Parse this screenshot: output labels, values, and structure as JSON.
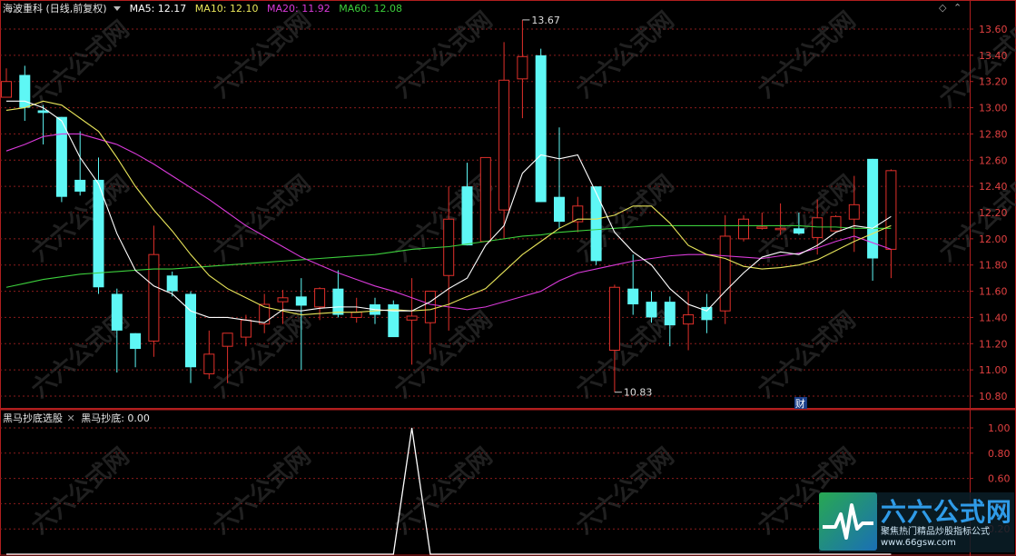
{
  "header": {
    "title": "海波重科 (日线,前复权)",
    "ma5": "MA5: 12.17",
    "ma10": "MA10: 12.10",
    "ma20": "MA20: 11.92",
    "ma60": "MA60: 12.08",
    "corner_icon": "diamond-icon",
    "menu_icon": "chevron-down-icon"
  },
  "indicator": {
    "name": "黑马抄底选股",
    "value_label": "黑马抄底: 0.00",
    "close_icon": "close-icon"
  },
  "price_axis": [
    "13.60",
    "13.40",
    "13.20",
    "13.00",
    "12.80",
    "12.60",
    "12.40",
    "12.20",
    "12.00",
    "11.80",
    "11.60",
    "11.40",
    "11.20",
    "11.00",
    "10.80"
  ],
  "indicator_axis": [
    "1.00",
    "0.80",
    "0.60",
    "0.40",
    "0.20"
  ],
  "annotations": {
    "high": "13.67",
    "low": "10.83",
    "fin_badge": "财"
  },
  "watermark": "六六公式网",
  "brand": {
    "name": "六六公式网",
    "slogan": "聚焦热门精品炒股指标公式",
    "url": "www.66gsw.com"
  },
  "colors": {
    "up": "#e0302a",
    "down": "#5ef7f5",
    "ma5": "#ffffff",
    "ma10": "#e8e55a",
    "ma20": "#d93ad9",
    "ma60": "#3ccf3c",
    "grid": "#8a1c1c",
    "frame": "#b01e1e"
  },
  "chart_data": {
    "type": "candlestick",
    "price_range": [
      10.75,
      13.7
    ],
    "candles": [
      {
        "o": 13.08,
        "h": 13.3,
        "l": 13.08,
        "c": 13.2
      },
      {
        "o": 13.25,
        "h": 13.32,
        "l": 12.9,
        "c": 13.0
      },
      {
        "o": 12.98,
        "h": 13.02,
        "l": 12.72,
        "c": 12.96
      },
      {
        "o": 12.93,
        "h": 12.93,
        "l": 12.28,
        "c": 12.32
      },
      {
        "o": 12.45,
        "h": 12.82,
        "l": 12.33,
        "c": 12.36
      },
      {
        "o": 12.45,
        "h": 12.62,
        "l": 11.58,
        "c": 11.63
      },
      {
        "o": 11.58,
        "h": 11.62,
        "l": 10.98,
        "c": 11.3
      },
      {
        "o": 11.28,
        "h": 11.28,
        "l": 11.02,
        "c": 11.16
      },
      {
        "o": 11.22,
        "h": 12.1,
        "l": 11.1,
        "c": 11.88
      },
      {
        "o": 11.72,
        "h": 11.75,
        "l": 11.56,
        "c": 11.6
      },
      {
        "o": 11.58,
        "h": 11.6,
        "l": 10.9,
        "c": 11.02
      },
      {
        "o": 10.97,
        "h": 11.3,
        "l": 10.93,
        "c": 11.12
      },
      {
        "o": 11.18,
        "h": 11.28,
        "l": 10.9,
        "c": 11.28
      },
      {
        "o": 11.25,
        "h": 11.42,
        "l": 11.18,
        "c": 11.38
      },
      {
        "o": 11.35,
        "h": 11.58,
        "l": 11.28,
        "c": 11.5
      },
      {
        "o": 11.52,
        "h": 11.61,
        "l": 11.35,
        "c": 11.55
      },
      {
        "o": 11.56,
        "h": 11.7,
        "l": 11.0,
        "c": 11.49
      },
      {
        "o": 11.48,
        "h": 11.63,
        "l": 11.38,
        "c": 11.62
      },
      {
        "o": 11.62,
        "h": 11.76,
        "l": 11.4,
        "c": 11.42
      },
      {
        "o": 11.4,
        "h": 11.55,
        "l": 11.36,
        "c": 11.44
      },
      {
        "o": 11.5,
        "h": 11.55,
        "l": 11.35,
        "c": 11.42
      },
      {
        "o": 11.5,
        "h": 11.53,
        "l": 11.28,
        "c": 11.25
      },
      {
        "o": 11.38,
        "h": 11.7,
        "l": 11.04,
        "c": 11.41
      },
      {
        "o": 11.36,
        "h": 11.6,
        "l": 11.12,
        "c": 11.6
      },
      {
        "o": 11.72,
        "h": 12.4,
        "l": 11.3,
        "c": 12.15
      },
      {
        "o": 12.4,
        "h": 12.58,
        "l": 11.95,
        "c": 11.95
      },
      {
        "o": 11.98,
        "h": 12.6,
        "l": 11.98,
        "c": 12.62
      },
      {
        "o": 12.22,
        "h": 13.5,
        "l": 12.0,
        "c": 13.21
      },
      {
        "o": 13.22,
        "h": 13.67,
        "l": 12.92,
        "c": 13.39
      },
      {
        "o": 13.4,
        "h": 13.45,
        "l": 12.28,
        "c": 12.28
      },
      {
        "o": 12.32,
        "h": 12.85,
        "l": 12.08,
        "c": 12.13
      },
      {
        "o": 12.13,
        "h": 12.32,
        "l": 12.05,
        "c": 12.25
      },
      {
        "o": 12.4,
        "h": 12.4,
        "l": 11.8,
        "c": 11.83
      },
      {
        "o": 11.15,
        "h": 11.65,
        "l": 10.83,
        "c": 11.63
      },
      {
        "o": 11.62,
        "h": 11.88,
        "l": 11.42,
        "c": 11.5
      },
      {
        "o": 11.52,
        "h": 11.6,
        "l": 11.36,
        "c": 11.4
      },
      {
        "o": 11.52,
        "h": 11.56,
        "l": 11.18,
        "c": 11.34
      },
      {
        "o": 11.35,
        "h": 11.6,
        "l": 11.15,
        "c": 11.42
      },
      {
        "o": 11.48,
        "h": 11.58,
        "l": 11.28,
        "c": 11.38
      },
      {
        "o": 11.45,
        "h": 12.18,
        "l": 11.35,
        "c": 12.02
      },
      {
        "o": 12.0,
        "h": 12.18,
        "l": 11.98,
        "c": 12.15
      },
      {
        "o": 12.08,
        "h": 12.2,
        "l": 12.07,
        "c": 12.09
      },
      {
        "o": 12.08,
        "h": 12.27,
        "l": 12.03,
        "c": 12.08
      },
      {
        "o": 12.08,
        "h": 12.2,
        "l": 12.03,
        "c": 12.04
      },
      {
        "o": 12.01,
        "h": 12.3,
        "l": 11.88,
        "c": 12.16
      },
      {
        "o": 12.06,
        "h": 12.18,
        "l": 12.06,
        "c": 12.17
      },
      {
        "o": 12.15,
        "h": 12.48,
        "l": 11.9,
        "c": 12.26
      },
      {
        "o": 12.61,
        "h": 12.61,
        "l": 11.68,
        "c": 11.85
      },
      {
        "o": 11.92,
        "h": 12.53,
        "l": 11.7,
        "c": 12.52
      }
    ],
    "ma5": [
      13.05,
      13.05,
      13.0,
      12.9,
      12.62,
      12.42,
      12.04,
      11.76,
      11.64,
      11.58,
      11.45,
      11.4,
      11.4,
      11.38,
      11.36,
      11.46,
      11.45,
      11.47,
      11.48,
      11.48,
      11.46,
      11.45,
      11.45,
      11.52,
      11.62,
      11.7,
      11.95,
      12.1,
      12.5,
      12.64,
      12.61,
      12.64,
      12.35,
      12.05,
      11.9,
      11.8,
      11.62,
      11.5,
      11.45,
      11.6,
      11.74,
      11.86,
      11.9,
      11.88,
      11.95,
      12.05,
      12.1,
      12.08,
      12.17
    ],
    "ma10": [
      12.98,
      13.0,
      13.05,
      13.02,
      12.92,
      12.82,
      12.62,
      12.4,
      12.22,
      12.06,
      11.88,
      11.72,
      11.62,
      11.55,
      11.48,
      11.45,
      11.42,
      11.43,
      11.44,
      11.44,
      11.45,
      11.46,
      11.45,
      11.46,
      11.5,
      11.56,
      11.62,
      11.75,
      11.88,
      11.98,
      12.08,
      12.15,
      12.15,
      12.18,
      12.25,
      12.25,
      12.12,
      11.95,
      11.88,
      11.85,
      11.79,
      11.77,
      11.78,
      11.8,
      11.84,
      11.91,
      11.98,
      12.04,
      12.1
    ],
    "ma20": [
      12.67,
      12.72,
      12.78,
      12.8,
      12.8,
      12.76,
      12.72,
      12.65,
      12.57,
      12.48,
      12.39,
      12.3,
      12.2,
      12.1,
      12.02,
      11.94,
      11.86,
      11.8,
      11.74,
      11.69,
      11.64,
      11.6,
      11.55,
      11.5,
      11.48,
      11.46,
      11.48,
      11.52,
      11.56,
      11.6,
      11.68,
      11.74,
      11.77,
      11.8,
      11.83,
      11.85,
      11.87,
      11.88,
      11.88,
      11.87,
      11.86,
      11.85,
      11.87,
      11.89,
      11.93,
      11.98,
      12.02,
      11.97,
      11.92
    ],
    "ma60": [
      11.63,
      11.66,
      11.69,
      11.71,
      11.73,
      11.74,
      11.75,
      11.76,
      11.77,
      11.77,
      11.78,
      11.79,
      11.8,
      11.81,
      11.82,
      11.83,
      11.84,
      11.85,
      11.86,
      11.87,
      11.88,
      11.9,
      11.92,
      11.93,
      11.94,
      11.96,
      11.98,
      12.0,
      12.02,
      12.03,
      12.05,
      12.06,
      12.07,
      12.08,
      12.09,
      12.1,
      12.1,
      12.1,
      12.1,
      12.1,
      12.1,
      12.1,
      12.1,
      12.1,
      12.09,
      12.09,
      12.08,
      12.08,
      12.08
    ],
    "indicator_values": [
      0,
      0,
      0,
      0,
      0,
      0,
      0,
      0,
      0,
      0,
      0,
      0,
      0,
      0,
      0,
      0,
      0,
      0,
      0,
      0,
      0,
      0,
      1,
      0,
      0,
      0,
      0,
      0,
      0,
      0,
      0,
      0,
      0,
      0,
      0,
      0,
      0,
      0,
      0,
      0,
      0,
      0,
      0,
      0,
      0,
      0,
      0,
      0,
      0
    ],
    "indicator_range": [
      0,
      1.1
    ]
  }
}
